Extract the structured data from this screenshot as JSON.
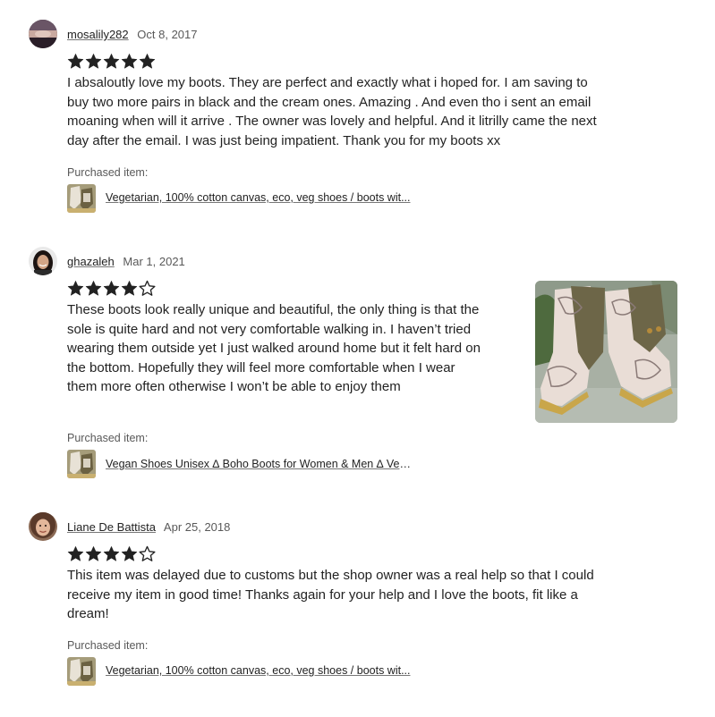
{
  "reviews": [
    {
      "reviewer": "mosalily282",
      "date": "Oct 8, 2017",
      "rating": 5,
      "text": "I absaloutly love my boots. They are perfect and exactly what i hoped for. I am saving to buy two more pairs in black and the cream ones. Amazing . And even tho i sent an email moaning when will it arrive . The owner was lovely and helpful. And it litrilly came the next day after the email. I was just being impatient. Thank you for my boots xx",
      "purchased_label": "Purchased item:",
      "item_title": "Vegetarian, 100% cotton canvas, eco, veg shoes / boots wit..."
    },
    {
      "reviewer": "ghazaleh",
      "date": "Mar 1, 2021",
      "rating": 4,
      "text": "These boots look really unique and beautiful, the only thing is that the sole is quite hard and not very comfortable walking in. I haven’t tried wearing them outside yet I just walked around home but it felt hard on the bottom. Hopefully they will feel more comfortable when I wear them more often otherwise I won’t be able to enjoy them",
      "purchased_label": "Purchased item:",
      "item_title": "Vegan Shoes Unisex ∆ Boho Boots for Women & Men ∆ Veg..."
    },
    {
      "reviewer": "Liane De Battista",
      "date": "Apr 25, 2018",
      "rating": 4,
      "text": "This item was delayed due to customs but the shop owner was a real help so that I could receive my item in good time! Thanks again for your help and I love the boots, fit like a dream!",
      "purchased_label": "Purchased item:",
      "item_title": "Vegetarian, 100% cotton canvas, eco, veg shoes / boots wit..."
    }
  ],
  "colors": {
    "star": "#222222",
    "muted_text": "#595959"
  }
}
